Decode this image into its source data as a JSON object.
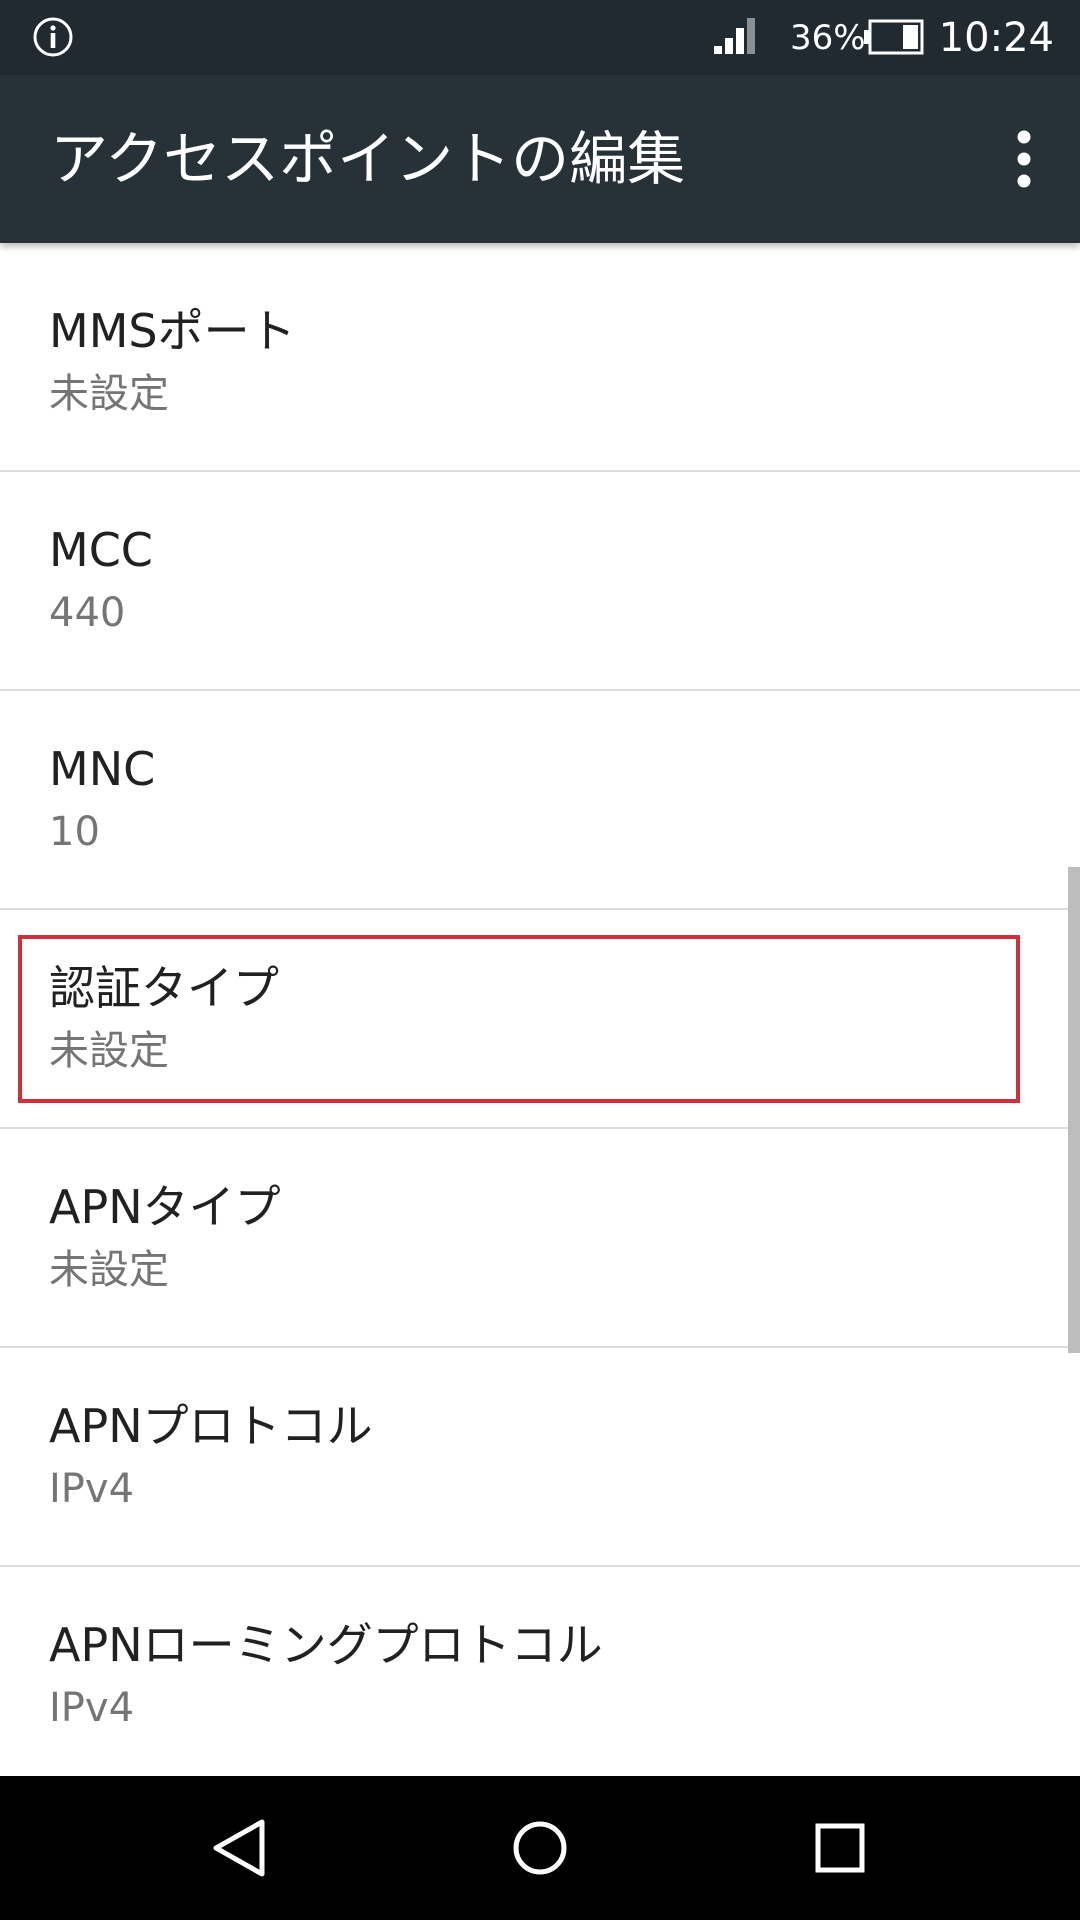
{
  "status_bar": {
    "info_icon": "info-circle-icon",
    "signal_icon": "cell-signal-icon",
    "battery_percent": "36%",
    "battery_level": 0.36,
    "battery_icon": "battery-icon",
    "time": "10:24"
  },
  "app_bar": {
    "title": "アクセスポイントの編集",
    "menu_icon": "more-vert-icon",
    "background": "#263238"
  },
  "list": {
    "items": [
      {
        "title": "MMSポート",
        "value": "未設定"
      },
      {
        "title": "MCC",
        "value": "440"
      },
      {
        "title": "MNC",
        "value": "10"
      },
      {
        "title": "認証タイプ",
        "value": "未設定",
        "highlighted": true
      },
      {
        "title": "APNタイプ",
        "value": "未設定"
      },
      {
        "title": "APNプロトコル",
        "value": "IPv4"
      },
      {
        "title": "APNローミングプロトコル",
        "value": "IPv4"
      }
    ],
    "highlight_color": "#d32f3a"
  },
  "nav_bar": {
    "back_icon": "back-triangle-icon",
    "home_icon": "home-circle-icon",
    "recents_icon": "recents-square-icon"
  }
}
